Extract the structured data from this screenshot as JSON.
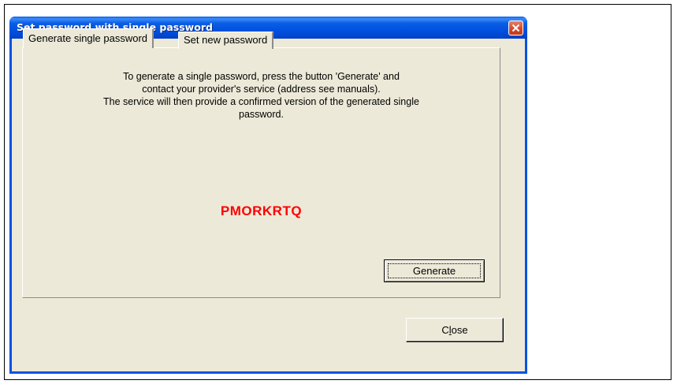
{
  "window": {
    "title": "Set password with single password"
  },
  "tabs": [
    {
      "label": "Generate single password",
      "active": true
    },
    {
      "label": "Set new password",
      "active": false
    }
  ],
  "description": {
    "line1": "To generate a single password, press the button 'Generate' and",
    "line2": "contact your provider's service (address see manuals).",
    "line3": "The service will then provide a confirmed version of the generated single",
    "line4": "password."
  },
  "password": {
    "value": "PMORKRTQ",
    "color": "#ff0000"
  },
  "buttons": {
    "generate_label": "Generate",
    "close_prefix": "C",
    "close_accel": "l",
    "close_suffix": "ose"
  },
  "colors": {
    "titlebar": "#0054e3",
    "dialog_bg": "#ece9d8",
    "close_button": "#d2462a"
  },
  "icons": {
    "close": "close-icon"
  }
}
